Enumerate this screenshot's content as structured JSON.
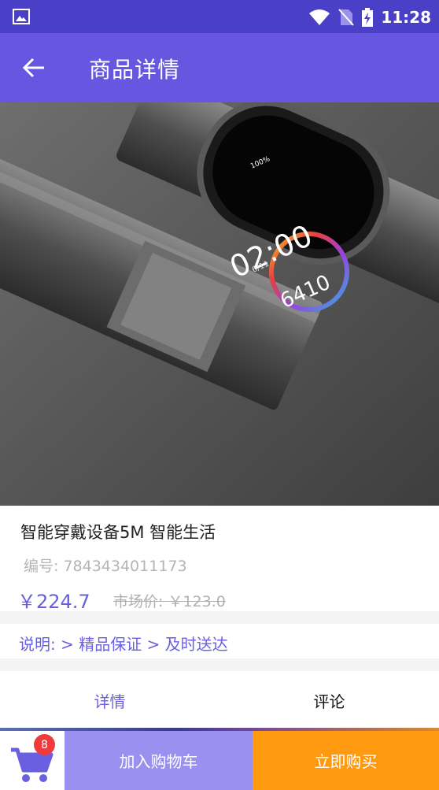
{
  "status_bar": {
    "time": "11:28",
    "icons": [
      "image-icon",
      "wifi-icon",
      "no-sim-icon",
      "battery-charging-icon"
    ]
  },
  "app_bar": {
    "title": "商品详情",
    "back_icon": "arrow-back-icon"
  },
  "product": {
    "image": {
      "watch_time": "02:00",
      "watch_date": "6/11",
      "watch_battery": "100%",
      "watch_steps": "6410"
    },
    "name": "智能穿戴设备5M 智能生活",
    "code_text": "编号: 7843434011173",
    "price_text": "￥224.7",
    "market_price_text": "市场价: ￥123.0"
  },
  "description": {
    "text": "说明: > 精品保证 > 及时送达"
  },
  "tabs": [
    {
      "label": "详情",
      "active": true
    },
    {
      "label": "评论",
      "active": false
    }
  ],
  "bottom_bar": {
    "cart_icon": "shopping-cart-icon",
    "cart_count": "8",
    "add_to_cart_label": "加入购物车",
    "buy_now_label": "立即购买"
  },
  "colors": {
    "status_bar": "#4a3fc7",
    "app_bar": "#6656e0",
    "accent": "#6a5fe0",
    "add_to_cart": "#9a90f0",
    "buy_now": "#ff9a10",
    "badge": "#ef3b3b"
  }
}
